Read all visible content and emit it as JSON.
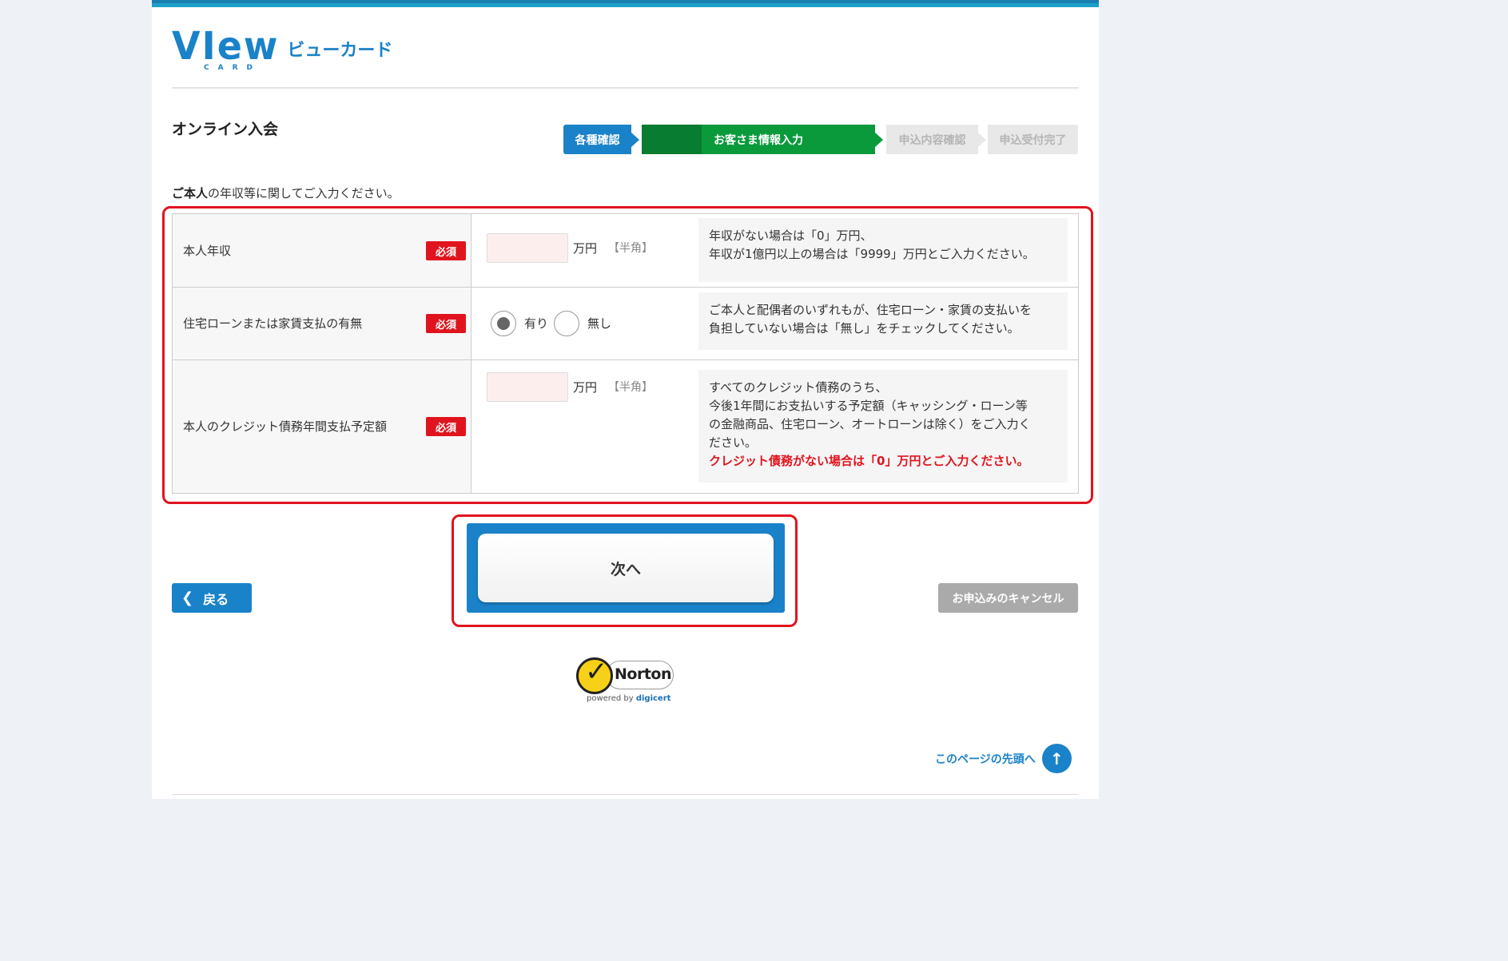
{
  "brand": {
    "logo_text": "VIew",
    "logo_sub": "CARD",
    "kana": "ビューカード"
  },
  "page_title": "オンライン入会",
  "steps": [
    {
      "label": "各種確認",
      "state": "done"
    },
    {
      "label": "お客さま情報入力",
      "state": "current"
    },
    {
      "label": "申込内容確認",
      "state": "todo"
    },
    {
      "label": "申込受付完了",
      "state": "todo"
    }
  ],
  "lead": {
    "bold": "ご本人",
    "rest": "の年収等に関してご入力ください。"
  },
  "required_badge": "必須",
  "fields": {
    "income": {
      "label": "本人年収",
      "value": "",
      "unit": "万円",
      "hint": "【半角】",
      "note_line1": "年収がない場合は「0」万円、",
      "note_line2": "年収が1億円以上の場合は「9999」万円とご入力ください。"
    },
    "housing": {
      "label": "住宅ローンまたは家賃支払の有無",
      "options": [
        {
          "label": "有り",
          "checked": true
        },
        {
          "label": "無し",
          "checked": false
        }
      ],
      "note_line1": "ご本人と配偶者のいずれもが、住宅ローン・家賃の支払いを",
      "note_line2": "負担していない場合は「無し」をチェックしてください。"
    },
    "credit": {
      "label": "本人のクレジット債務年間支払予定額",
      "value": "",
      "unit": "万円",
      "hint": "【半角】",
      "note_line1": "すべてのクレジット債務のうち、",
      "note_line2": "今後1年間にお支払いする予定額（キャッシング・ローン等",
      "note_line3": "の金融商品、住宅ローン、オートローンは除く）をご入力く",
      "note_line4": "ださい。",
      "note_red": "クレジット債務がない場合は「0」万円とご入力ください。"
    }
  },
  "buttons": {
    "next": "次へ",
    "back": "戻る",
    "cancel": "お申込みのキャンセル"
  },
  "norton": {
    "word": "Norton",
    "powered": "powered by",
    "brand": "digicert"
  },
  "page_top": "このページの先頭へ"
}
